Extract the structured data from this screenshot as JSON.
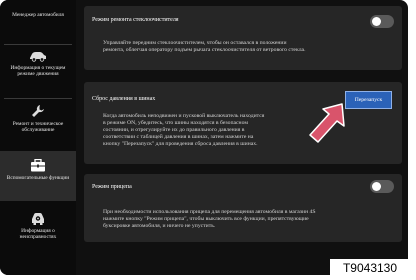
{
  "sidebar": {
    "items": [
      {
        "label": "Менеджер автомобиля",
        "icon": "none",
        "active": false
      },
      {
        "label": "Информация о текущем режиме движения",
        "icon": "car-icon",
        "active": false
      },
      {
        "label": "Ремонт и техническое обслуживание",
        "icon": "wrench-icon",
        "active": false
      },
      {
        "label": "Вспомогательные функции",
        "icon": "toolbox-icon",
        "active": true
      },
      {
        "label": "Информация о неисправностях",
        "icon": "car-fault-icon",
        "active": false
      }
    ]
  },
  "cards": {
    "wiper": {
      "title": "Режим ремонта стеклоочистителя",
      "description": "Управляйте передним стеклоочистителем, чтобы он оставался в положении\nремонта, облегчая оператору подъем рычага стеклоочистителя от ветрового стекла.",
      "toggle_on": false
    },
    "tire_pressure": {
      "title": "Сброс давления в шинах",
      "description": "Когда автомобиль неподвижен и пусковой выключатель находится\nв режиме ON, убедитесь, что шины находятся в безопасном\nсостоянии, и отрегулируйте их до правильного давления в\nсоответствии с таблицей давления в шинах, затем нажмите на\nкнопку \"Перезапуск\" для проведения сброса давления в шинах.",
      "button_label": "Перезапуск"
    },
    "trailer": {
      "title": "Режим прицепа",
      "description": "При необходимости использования прицепа для перемещения автомобиля в магазин 4S\nнажмите кнопку \"Режим прицепа\", чтобы выключить все функции, препятствующие\nбуксировке автомобиля, и ничего не упустить.",
      "toggle_on": false
    }
  },
  "figure_code": "T9043130",
  "colors": {
    "screen_bg": "#101010",
    "sidebar_bg": "#0b0b0b",
    "card_bg": "#262626",
    "active_nav_bg": "#2c2c2c",
    "button_blue": "#2b62b8",
    "arrow_red": "#d9546b"
  }
}
